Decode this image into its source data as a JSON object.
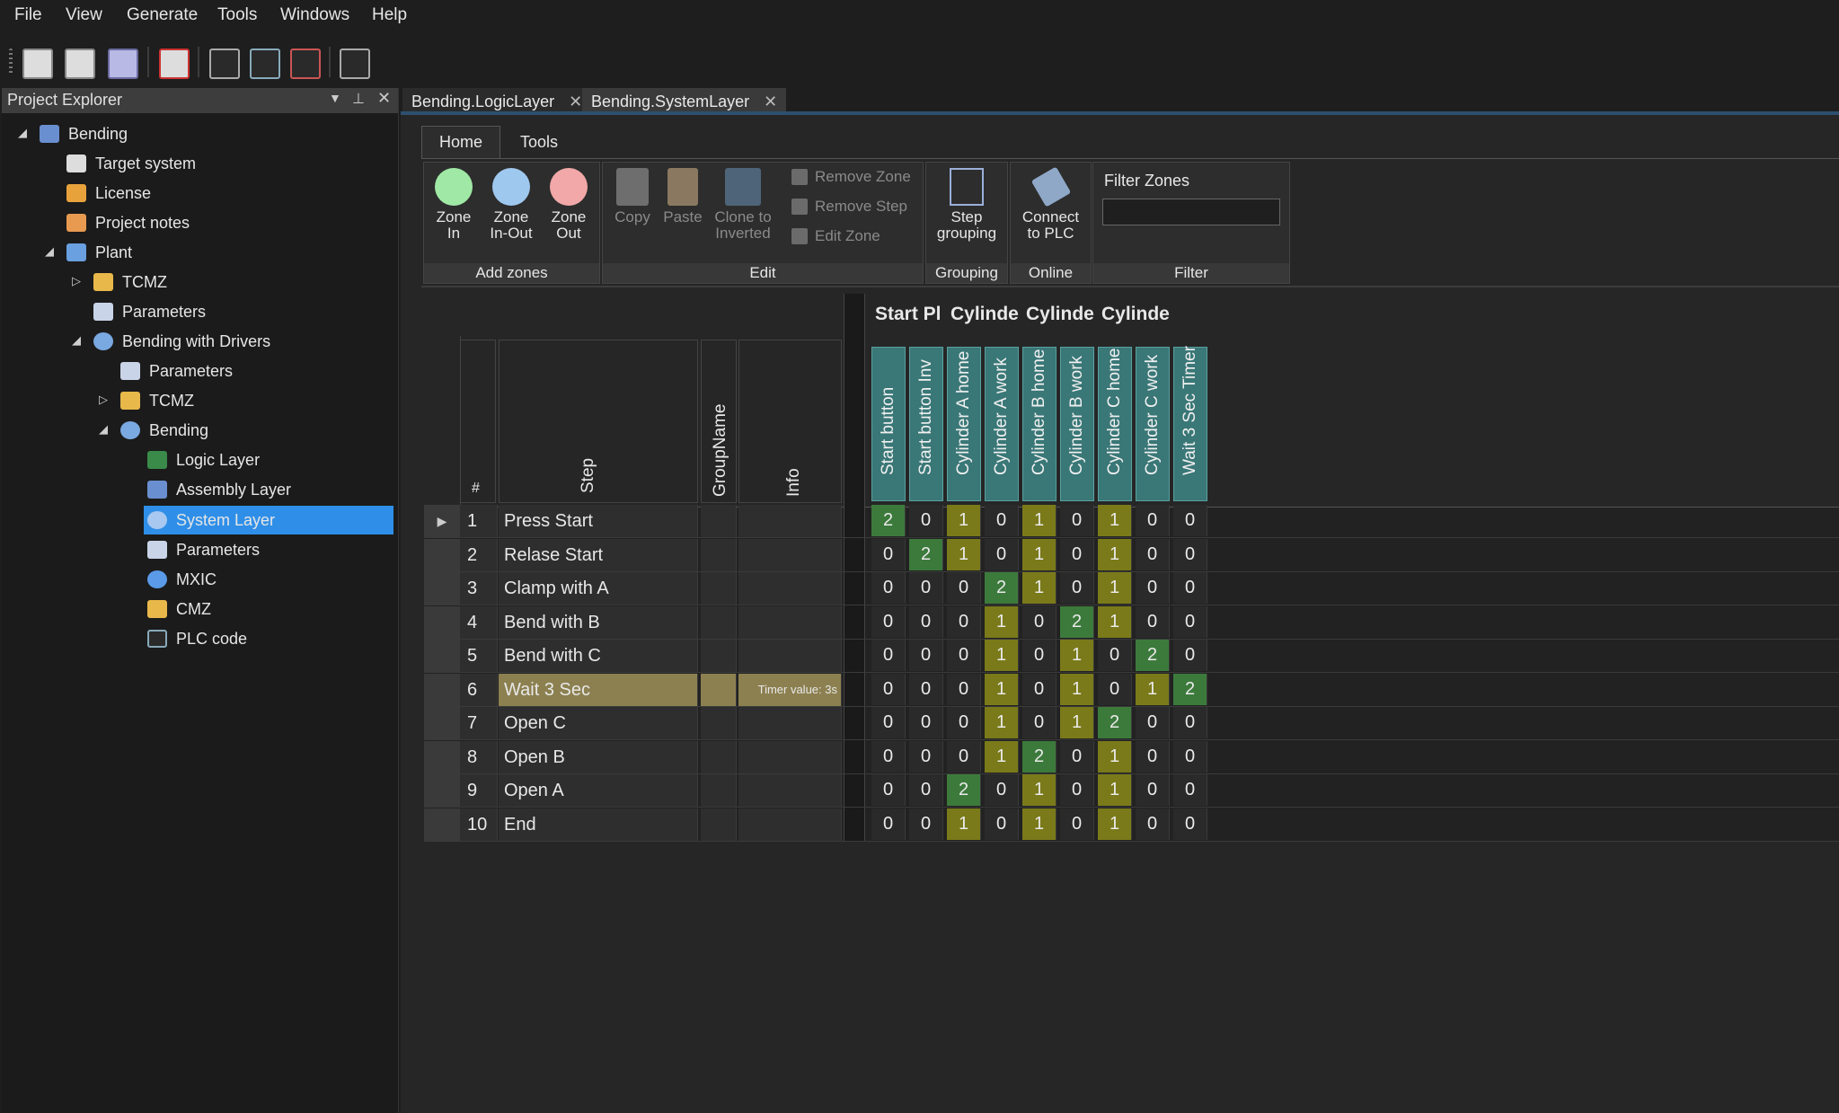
{
  "menu": [
    "File",
    "View",
    "Generate",
    "Tools",
    "Windows",
    "Help"
  ],
  "toolbar_icons": [
    "new-project-icon",
    "open-project-icon",
    "save-icon",
    "close-project-icon",
    "system-layer-icon",
    "code-icon",
    "plc-code-icon",
    "home-icon"
  ],
  "explorer": {
    "title": "Project Explorer",
    "items": [
      {
        "label": "Bending",
        "icon": "project-icon"
      },
      {
        "label": "Target system",
        "icon": "target-system-icon"
      },
      {
        "label": "License",
        "icon": "key-icon"
      },
      {
        "label": "Project notes",
        "icon": "notes-icon"
      },
      {
        "label": "Plant",
        "icon": "plant-icon"
      },
      {
        "label": "TCMZ",
        "icon": "folder-icon"
      },
      {
        "label": "Parameters",
        "icon": "parameters-icon"
      },
      {
        "label": "Bending with Drivers",
        "icon": "cube-icon"
      },
      {
        "label": "Parameters",
        "icon": "parameters-icon"
      },
      {
        "label": "TCMZ",
        "icon": "folder-icon"
      },
      {
        "label": "Bending",
        "icon": "cube-icon"
      },
      {
        "label": "Logic Layer",
        "icon": "logic-layer-icon"
      },
      {
        "label": "Assembly Layer",
        "icon": "assembly-layer-icon"
      },
      {
        "label": "System Layer",
        "icon": "system-layer-icon"
      },
      {
        "label": "Parameters",
        "icon": "parameters-icon"
      },
      {
        "label": "MXIC",
        "icon": "mxic-icon"
      },
      {
        "label": "CMZ",
        "icon": "folder-icon"
      },
      {
        "label": "PLC code",
        "icon": "plc-code-icon"
      }
    ],
    "selected": "System Layer"
  },
  "doc_tabs": [
    {
      "label": "Bending.LogicLayer"
    },
    {
      "label": "Bending.SystemLayer",
      "active": true
    }
  ],
  "ribbon": {
    "tabs": [
      "Home",
      "Tools"
    ],
    "active_tab": "Home",
    "groups": {
      "add_zones": {
        "label": "Add zones",
        "buttons": [
          "Zone In",
          "Zone In-Out",
          "Zone Out"
        ]
      },
      "edit": {
        "label": "Edit",
        "buttons": [
          "Copy",
          "Paste",
          "Clone to Inverted"
        ],
        "small": [
          "Remove Zone",
          "Remove Step",
          "Edit Zone"
        ]
      },
      "grouping": {
        "label": "Grouping",
        "button": "Step grouping"
      },
      "online": {
        "label": "Online",
        "button": "Connect to PLC"
      },
      "filter": {
        "label": "Filter",
        "title": "Filter Zones",
        "value": ""
      }
    }
  },
  "grid": {
    "left_headers": [
      "#",
      "Step",
      "GroupName",
      "Info"
    ],
    "group_headers": [
      "Start Pl",
      "Cylinde",
      "Cylinde",
      "Cylinde"
    ],
    "columns": [
      "Start button",
      "Start button Inv",
      "Cylinder A home",
      "Cylinder A work",
      "Cylinder B home",
      "Cylinder B work",
      "Cylinder C home",
      "Cylinder C work",
      "Wait 3 Sec Timer"
    ],
    "rows": [
      {
        "num": "1",
        "step": "Press Start",
        "info": "",
        "values": [
          2,
          0,
          1,
          0,
          1,
          0,
          1,
          0,
          0
        ]
      },
      {
        "num": "2",
        "step": "Relase Start",
        "info": "",
        "values": [
          0,
          2,
          1,
          0,
          1,
          0,
          1,
          0,
          0
        ]
      },
      {
        "num": "3",
        "step": "Clamp with A",
        "info": "",
        "values": [
          0,
          0,
          0,
          2,
          1,
          0,
          1,
          0,
          0
        ]
      },
      {
        "num": "4",
        "step": "Bend with B",
        "info": "",
        "values": [
          0,
          0,
          0,
          1,
          0,
          2,
          1,
          0,
          0
        ]
      },
      {
        "num": "5",
        "step": "Bend with C",
        "info": "",
        "values": [
          0,
          0,
          0,
          1,
          0,
          1,
          0,
          2,
          0
        ]
      },
      {
        "num": "6",
        "step": "Wait 3 Sec",
        "info": "Timer value: 3s",
        "values": [
          0,
          0,
          0,
          1,
          0,
          1,
          0,
          1,
          2
        ]
      },
      {
        "num": "7",
        "step": "Open C",
        "info": "",
        "values": [
          0,
          0,
          0,
          1,
          0,
          1,
          2,
          0,
          0
        ]
      },
      {
        "num": "8",
        "step": "Open B",
        "info": "",
        "values": [
          0,
          0,
          0,
          1,
          2,
          0,
          1,
          0,
          0
        ]
      },
      {
        "num": "9",
        "step": "Open A",
        "info": "",
        "values": [
          0,
          0,
          2,
          0,
          1,
          0,
          1,
          0,
          0
        ]
      },
      {
        "num": "10",
        "step": "End",
        "info": "",
        "values": [
          0,
          0,
          1,
          0,
          1,
          0,
          1,
          0,
          0
        ]
      }
    ],
    "current_row": "1",
    "highlighted_step": "6"
  },
  "colors": {
    "selection": "#2f8fe8",
    "zone_in": "#3c7a3c",
    "zone_active": "#7a7a1a",
    "header_teal": "#3a7777",
    "highlight_row": "#8c8050"
  }
}
